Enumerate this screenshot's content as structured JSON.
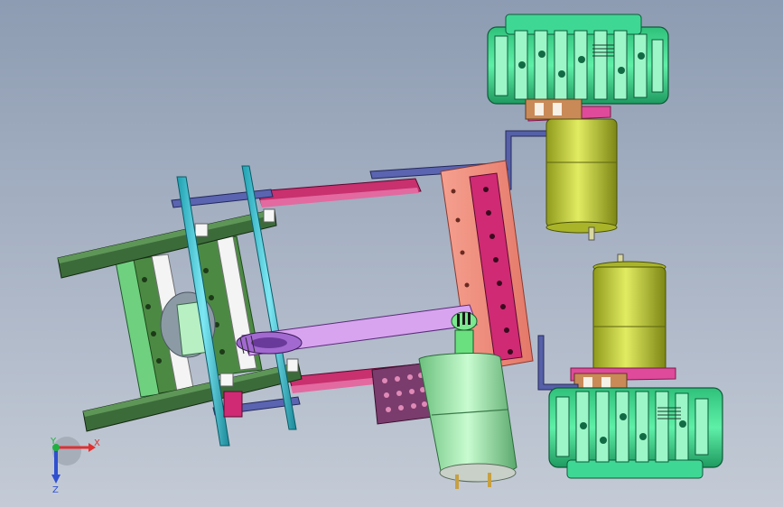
{
  "viewport": {
    "background_top": "#8d9cb2",
    "background_bottom": "#c4cbd6"
  },
  "colors": {
    "tread_green": "#3fd98f",
    "tread_dark": "#1a8a5a",
    "motor_yellow": "#c9d63a",
    "frame_green": "#3c6b3a",
    "rail_cyan": "#39c5d6",
    "plate_salmon": "#f08a7c",
    "magenta": "#c02870",
    "lavender": "#d8a4f0",
    "bracket_blue": "#5060a0",
    "motor_mint": "#a8f0b8",
    "block_maroon": "#7a3c6c"
  },
  "triad": {
    "x_label": "X",
    "y_label": "Y",
    "z_label": "Z",
    "x_color": "#e03030",
    "y_color": "#20b040",
    "z_color": "#3050d0"
  }
}
